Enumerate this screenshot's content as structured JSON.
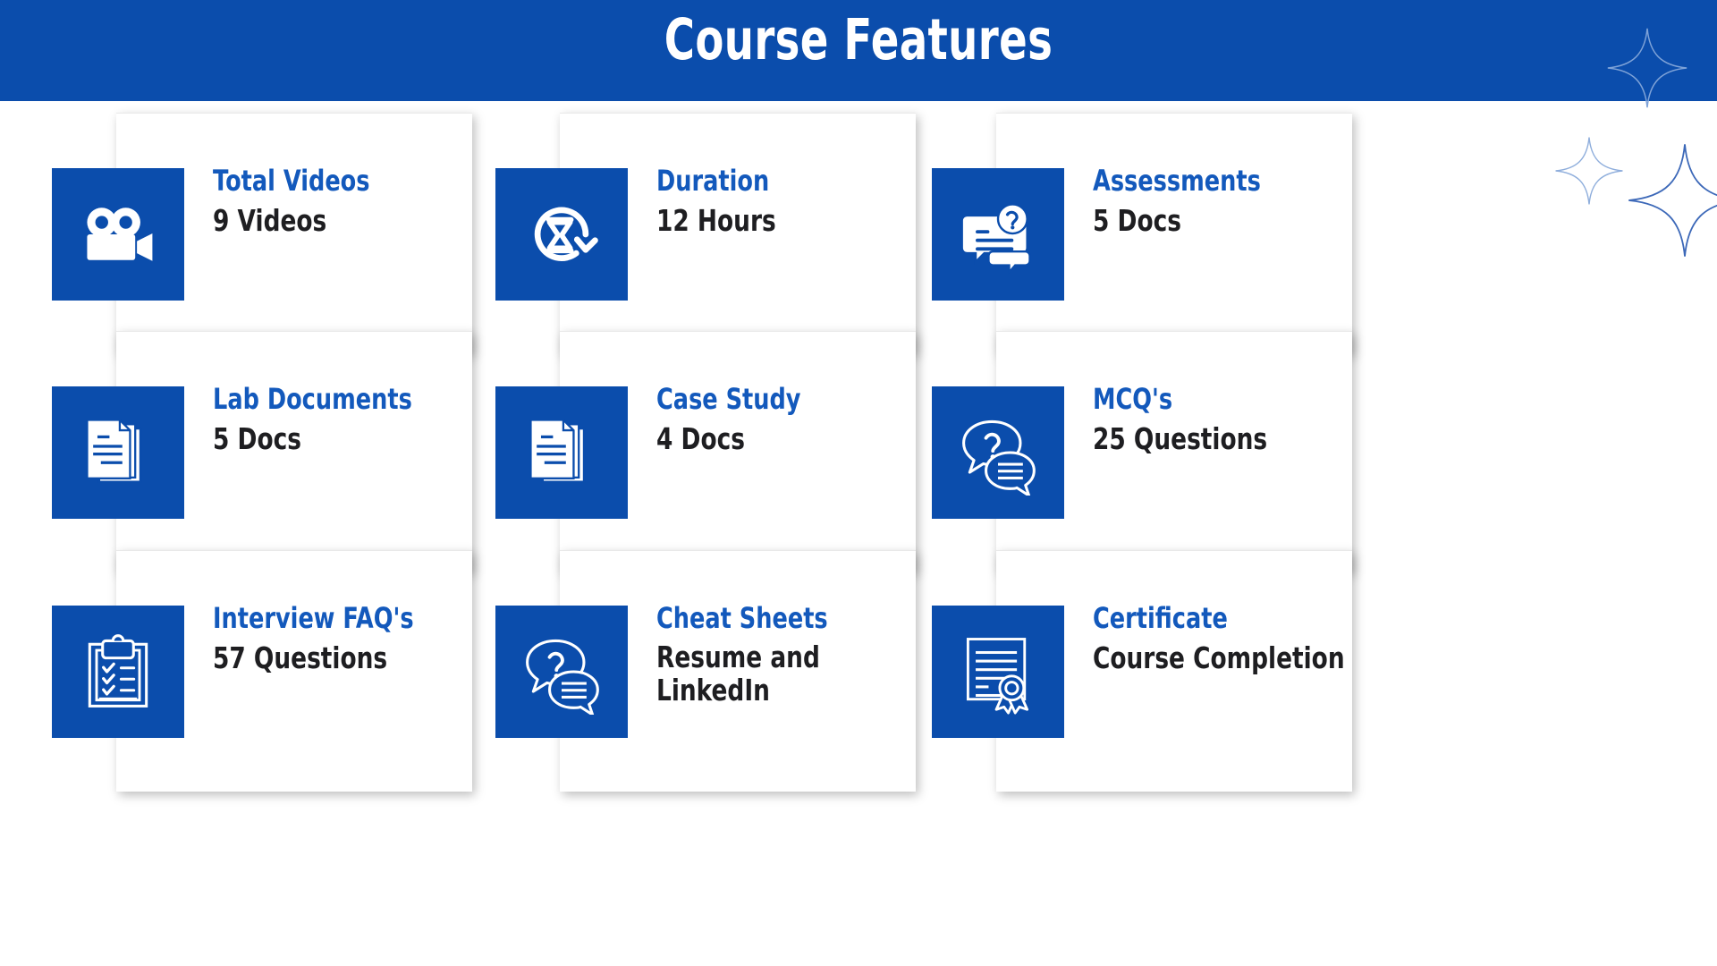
{
  "header": {
    "title": "Course Features",
    "background_color": "#0B4DAC",
    "text_color": "#ffffff"
  },
  "theme": {
    "brand_blue": "#0B4DAC",
    "title_blue": "#1359BC",
    "value_dark": "#1E1E21",
    "page_background": "#ffffff",
    "sparkle_stroke": "#3C68B8"
  },
  "decorations": [
    {
      "name": "sparkle-banner",
      "shape": "four-point-star-outline"
    },
    {
      "name": "sparkle-small",
      "shape": "four-point-star-outline"
    },
    {
      "name": "sparkle-large",
      "shape": "four-point-star-outline"
    }
  ],
  "cards": [
    {
      "id": "total-videos",
      "icon": "video-camera-icon",
      "title": "Total Videos",
      "value": "9 Videos",
      "row": 0,
      "col": 0
    },
    {
      "id": "duration",
      "icon": "hourglass-refresh-icon",
      "title": "Duration",
      "value": "12 Hours",
      "row": 0,
      "col": 1
    },
    {
      "id": "assessments",
      "icon": "chat-question-card-icon",
      "title": "Assessments",
      "value": "5 Docs",
      "row": 0,
      "col": 2
    },
    {
      "id": "lab-documents",
      "icon": "document-stack-icon",
      "title": "Lab Documents",
      "value": "5 Docs",
      "row": 1,
      "col": 0
    },
    {
      "id": "case-study",
      "icon": "document-stack-icon",
      "title": "Case Study",
      "value": "4 Docs",
      "row": 1,
      "col": 1
    },
    {
      "id": "mcqs",
      "icon": "speech-bubbles-question-icon",
      "title": "MCQ's",
      "value": "25 Questions",
      "row": 1,
      "col": 2
    },
    {
      "id": "interview-faqs",
      "icon": "clipboard-checklist-icon",
      "title": "Interview FAQ's",
      "value": "57 Questions",
      "row": 2,
      "col": 0
    },
    {
      "id": "cheat-sheets",
      "icon": "speech-bubbles-question-icon",
      "title": "Cheat Sheets",
      "value": "Resume and LinkedIn",
      "value_lines": [
        "Resume and",
        "LinkedIn"
      ],
      "row": 2,
      "col": 1
    },
    {
      "id": "certificate",
      "icon": "certificate-ribbon-icon",
      "title": "Certificate",
      "value": "Course Completion",
      "row": 2,
      "col": 2
    }
  ]
}
